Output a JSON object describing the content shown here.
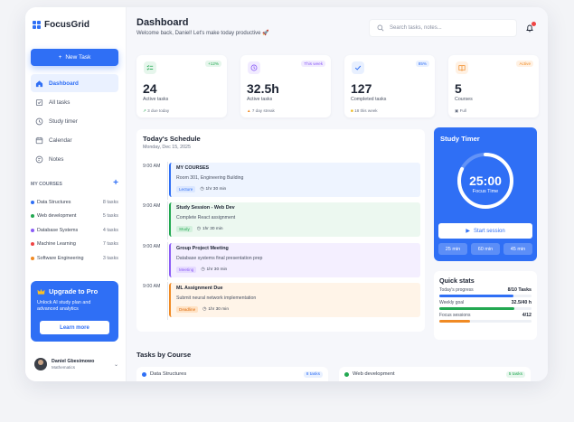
{
  "brand": {
    "name": "FocusGrid",
    "color": "#2f6ff5"
  },
  "sidebar": {
    "new_task": "New Task",
    "nav": [
      {
        "label": "Dashboard",
        "icon": "home-icon"
      },
      {
        "label": "All tasks",
        "icon": "list-icon"
      },
      {
        "label": "Study timer",
        "icon": "clock-icon"
      },
      {
        "label": "Calendar",
        "icon": "calendar-icon"
      },
      {
        "label": "Notes",
        "icon": "notes-icon"
      }
    ],
    "courses_title": "MY COURSES",
    "courses": [
      {
        "name": "Data Structures",
        "count": "8 tasks",
        "color": "#2f6ff5"
      },
      {
        "name": "Web development",
        "count": "5 tasks",
        "color": "#22a851"
      },
      {
        "name": "Database Systems",
        "count": "4 tasks",
        "color": "#8b5cf6"
      },
      {
        "name": "Machine Learning",
        "count": "7 tasks",
        "color": "#ef4444"
      },
      {
        "name": "Software Engineering",
        "count": "3 tasks",
        "color": "#f08a24"
      }
    ],
    "upgrade": {
      "title": "Upgrade to Pro",
      "desc": "Unlock AI study plan and advanced analytics",
      "button": "Learn more"
    },
    "user": {
      "name": "Daniel Gbesimowo",
      "role": "Mathematics"
    }
  },
  "header": {
    "title": "Dashboard",
    "subtitle": "Welcome back, Daniel! Let's make today productive 🚀",
    "search_placeholder": "Search tasks, notes..."
  },
  "stats": [
    {
      "value": "24",
      "label": "Active tasks",
      "tag": "+12%",
      "foot": "3 due today",
      "icon": "checklist-icon",
      "color": "#22a851",
      "bg": "#e6f6ec"
    },
    {
      "value": "32.5h",
      "label": "Active tasks",
      "tag": "This week",
      "foot": "7 day streak",
      "icon": "clock-icon",
      "color": "#8b5cf6",
      "bg": "#f1ebff"
    },
    {
      "value": "127",
      "label": "Completed tasks",
      "tag": "85%",
      "foot": "18 this week",
      "icon": "check-icon",
      "color": "#2f6ff5",
      "bg": "#e8f0ff"
    },
    {
      "value": "5",
      "label": "Courses",
      "tag": "Active",
      "foot": "Full",
      "icon": "book-icon",
      "color": "#f08a24",
      "bg": "#fff1e3"
    }
  ],
  "schedule": {
    "title": "Today's Schedule",
    "date": "Monday, Dec 15, 2025",
    "events": [
      {
        "time": "9:00 AM",
        "title": "MY COURSES",
        "desc": "Room 301, Engineering Building",
        "pill": "Lecture",
        "duration": "1hr 30 min",
        "color": "#2f6ff5",
        "bg": "#eef4ff",
        "pill_bg": "#dbe7ff"
      },
      {
        "time": "9:00 AM",
        "title": "Study Session - Web Dev",
        "desc": "Complete React assignment",
        "pill": "Study",
        "duration": "1hr 30 min",
        "color": "#22a851",
        "bg": "#ecf8f0",
        "pill_bg": "#d3f0dd"
      },
      {
        "time": "9:00 AM",
        "title": "Group Project Meeting",
        "desc": "Database systems final presentation prep",
        "pill": "Meeting",
        "duration": "1hr 30 min",
        "color": "#8b5cf6",
        "bg": "#f4efff",
        "pill_bg": "#e6dbff"
      },
      {
        "time": "9:00 AM",
        "title": "ML Assignment Due",
        "desc": "Submit neural network implementation",
        "pill": "Deadline",
        "duration": "1hr 30 min",
        "color": "#f08a24",
        "bg": "#fff4e8",
        "pill_bg": "#ffe2c4"
      }
    ]
  },
  "timer": {
    "title": "Study Timer",
    "time": "25:00",
    "label": "Focus Time",
    "start": "Start session",
    "options": [
      "25 min",
      "60 min",
      "45 min"
    ]
  },
  "quick_stats": {
    "title": "Quick stats",
    "rows": [
      {
        "label": "Today's progress",
        "value": "8/10 Tasks",
        "fraction": 0.8,
        "color": "#2f6ff5"
      },
      {
        "label": "Weekly goal",
        "value": "32.5/40 h",
        "fraction": 0.81,
        "color": "#22a851"
      },
      {
        "label": "Focus sessions",
        "value": "4/12",
        "fraction": 0.33,
        "color": "#f08a24"
      }
    ]
  },
  "tasks_by_course": {
    "title": "Tasks by Course",
    "cards": [
      {
        "name": "Data Structures",
        "count": "8 tasks",
        "color": "#2f6ff5",
        "bg": "#e8f0ff"
      },
      {
        "name": "Web development",
        "count": "5 tasks",
        "color": "#22a851",
        "bg": "#e6f6ec"
      }
    ]
  }
}
